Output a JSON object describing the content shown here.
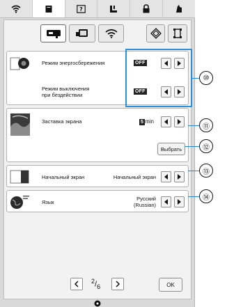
{
  "topbar": {
    "tabs": [
      {
        "icon": "wifi-icon"
      },
      {
        "icon": "document-icon"
      },
      {
        "icon": "help-icon"
      },
      {
        "icon": "boot-icon"
      },
      {
        "icon": "lock-icon"
      },
      {
        "icon": "bobbin-icon"
      }
    ]
  },
  "subtabs": [
    {
      "icon": "sewing-machine-icon"
    },
    {
      "icon": "embroidery-unit-icon"
    },
    {
      "icon": "wireless-icon"
    },
    {
      "icon": "settings-diamond-icon"
    },
    {
      "icon": "frame-icon"
    }
  ],
  "settings": {
    "eco": {
      "label": "Режим энергосбережения",
      "value": "OFF"
    },
    "shutdown": {
      "label_line1": "Режим выключения",
      "label_line2": "при бездействии",
      "value": "OFF"
    },
    "screensaver": {
      "label": "Заставка экрана",
      "value_num": "5",
      "value_unit": "min",
      "select_button": "Выбрать"
    },
    "home": {
      "label": "Начальный экран",
      "value": "Начальный экран"
    },
    "language": {
      "label": "Язык",
      "value_line1": "Русский",
      "value_line2": "(Russian)"
    }
  },
  "callouts": [
    "⑩",
    "⑪",
    "⑫",
    "⑬",
    "⑭"
  ],
  "pager": {
    "current": "2",
    "total": "6",
    "ok": "OK"
  }
}
